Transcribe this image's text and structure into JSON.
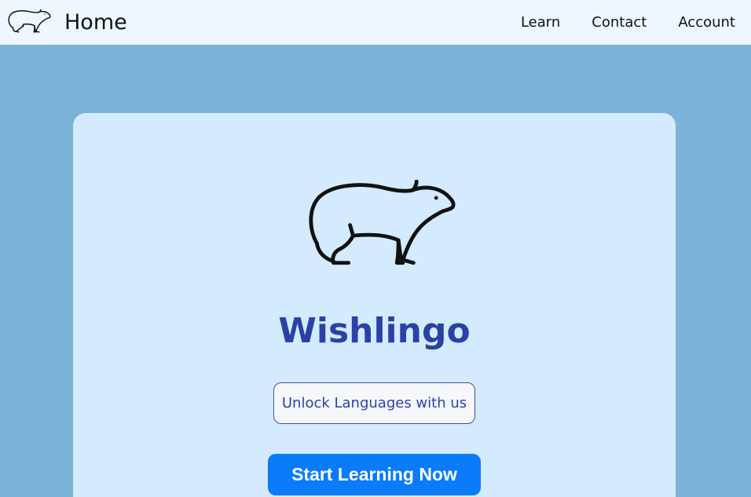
{
  "navbar": {
    "brand_label": "Home",
    "brand_icon": "capybara-icon",
    "links": [
      {
        "label": "Learn"
      },
      {
        "label": "Contact"
      },
      {
        "label": "Account"
      }
    ]
  },
  "hero": {
    "icon": "capybara-icon",
    "title": "Wishlingo",
    "tagline": "Unlock Languages with us",
    "cta_label": "Start Learning Now"
  },
  "colors": {
    "page_background": "#7cb2d8",
    "navbar_background": "#eef7ff",
    "card_background": "#d4eafe",
    "title": "#2a42a6",
    "cta_background": "#0a7bfa"
  }
}
